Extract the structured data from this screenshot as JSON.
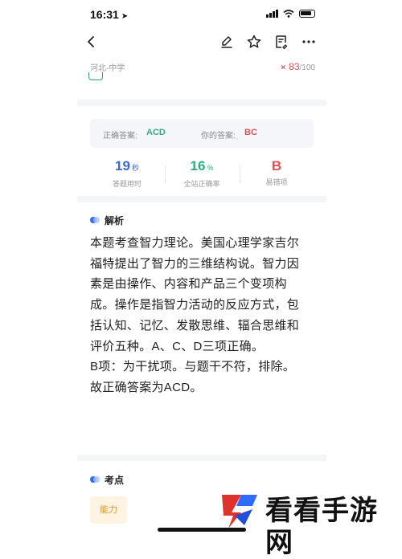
{
  "status": {
    "time": "16:31",
    "location_arrow": "➤"
  },
  "nav": {
    "icons": [
      "back-icon",
      "edit-icon",
      "star-icon",
      "note-icon",
      "more-icon"
    ]
  },
  "meta": {
    "region": "河北-中学",
    "wrong_mark": "×",
    "score": "83",
    "score_total": "/100"
  },
  "answer": {
    "correct_label": "正确答案:",
    "correct_value": "ACD",
    "yours_label": "你的答案:",
    "yours_value": "BC"
  },
  "stats": [
    {
      "value": "19",
      "unit": "秒",
      "label": "答题用时"
    },
    {
      "value": "16",
      "unit": "%",
      "label": "全站正确率"
    },
    {
      "value": "B",
      "unit": "",
      "label": "易错项"
    }
  ],
  "analysis": {
    "title": "解析",
    "lines": [
      "本题考查智力理论。美国心理学家吉尔",
      "福特提出了智力的三维结构说。智力因",
      "素是由操作、内容和产品三个变项构",
      "成。操作是指智力活动的反应方式，包",
      "括认知、记忆、发散思维、辐合思维和",
      "评价五种。A、C、D三项正确。",
      "B项：为干扰项。与题干不符，排除。",
      "故正确答案为ACD。"
    ]
  },
  "kaodian": {
    "title": "考点",
    "tag": "能力"
  },
  "watermark": {
    "text": "看看手游网"
  },
  "colors": {
    "correct": "#2fae7c",
    "wrong": "#e05050",
    "time_blue": "#3b66d9",
    "rate_green": "#2fae7c",
    "accent_blue": "#2f6bff",
    "tag_orange": "#e79a2a"
  }
}
